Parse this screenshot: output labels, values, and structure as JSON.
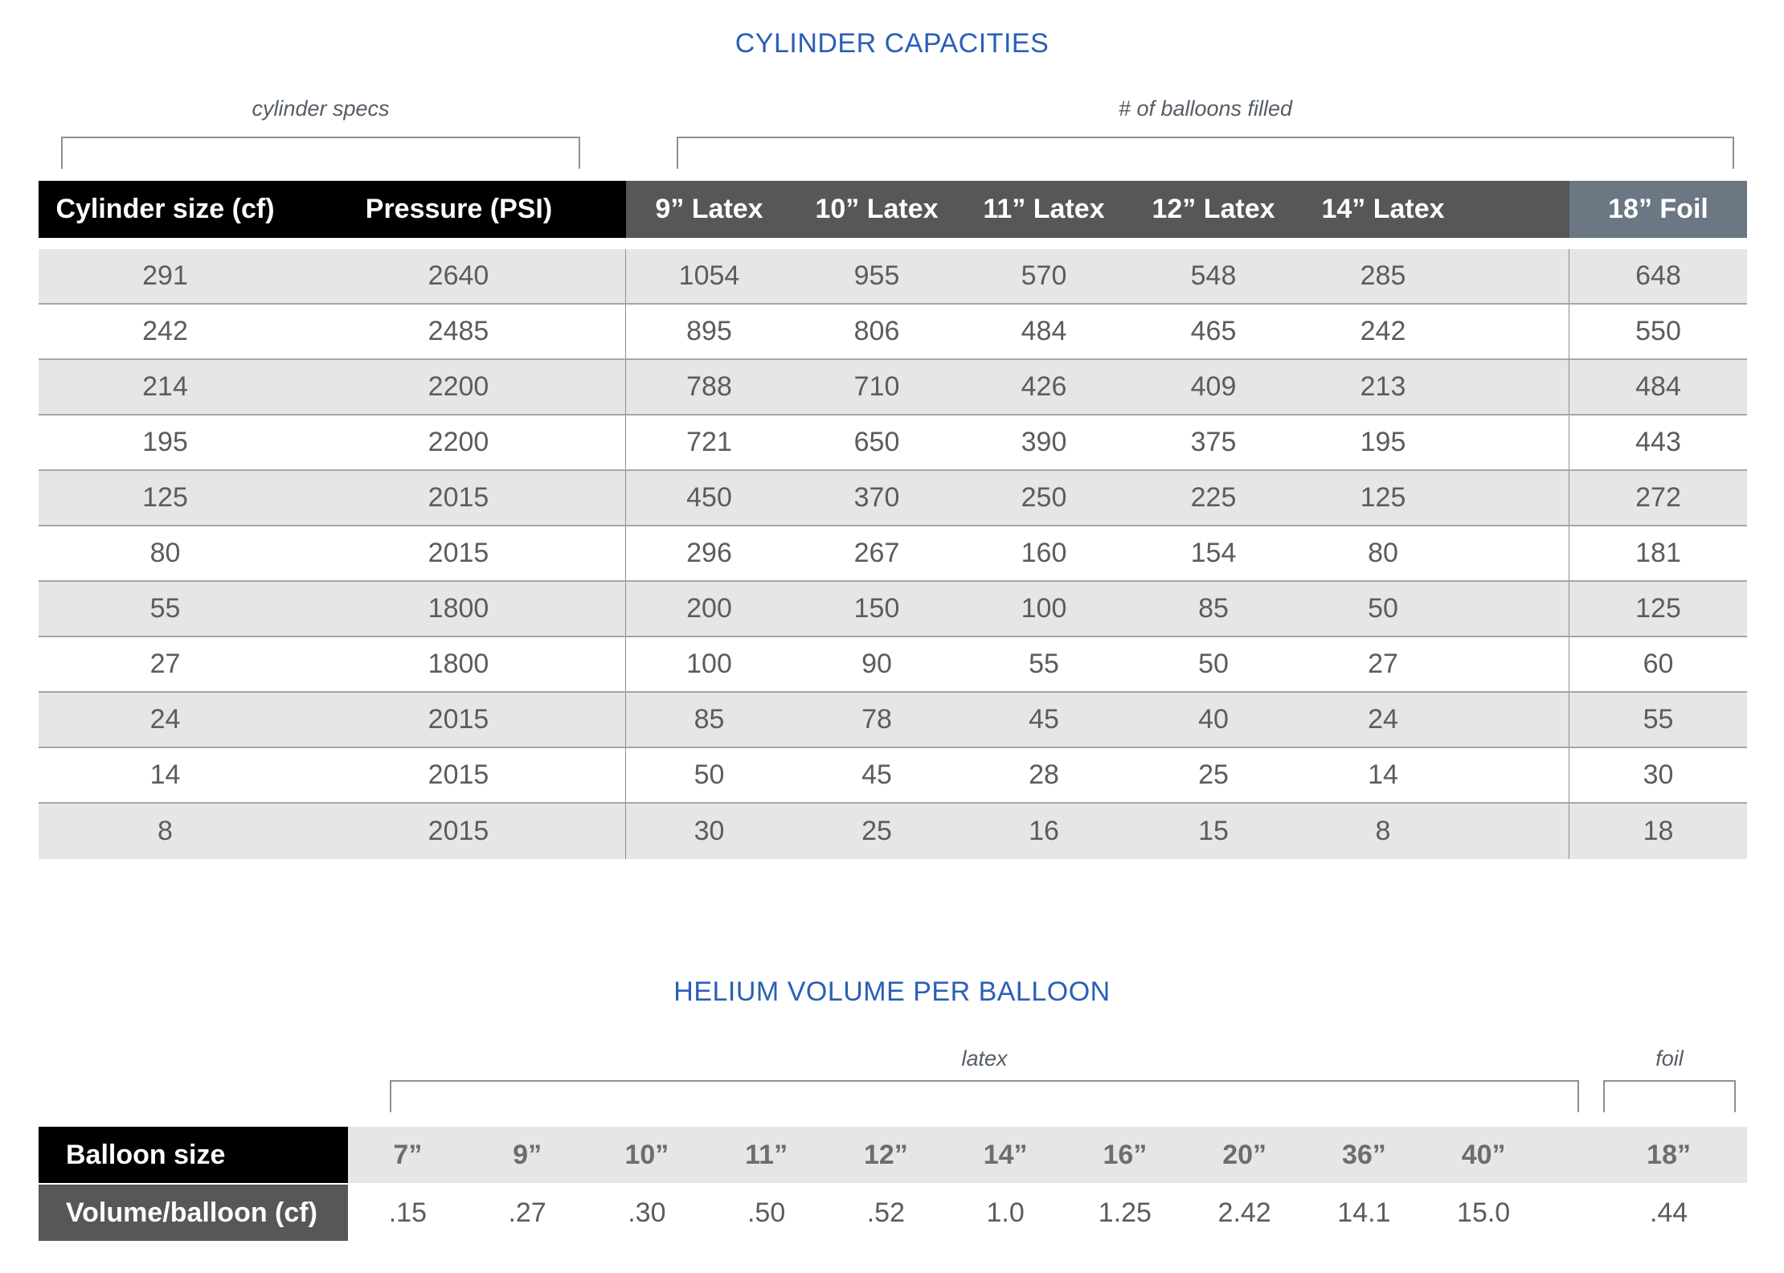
{
  "capacities": {
    "title": "CYLINDER CAPACITIES",
    "group_specs": "cylinder specs",
    "group_balloons": "# of balloons filled",
    "headers": [
      "Cylinder size (cf)",
      "Pressure (PSI)",
      "9” Latex",
      "10” Latex",
      "11” Latex",
      "12” Latex",
      "14” Latex",
      "18” Foil"
    ],
    "rows": [
      [
        "291",
        "2640",
        "1054",
        "955",
        "570",
        "548",
        "285",
        "648"
      ],
      [
        "242",
        "2485",
        "895",
        "806",
        "484",
        "465",
        "242",
        "550"
      ],
      [
        "214",
        "2200",
        "788",
        "710",
        "426",
        "409",
        "213",
        "484"
      ],
      [
        "195",
        "2200",
        "721",
        "650",
        "390",
        "375",
        "195",
        "443"
      ],
      [
        "125",
        "2015",
        "450",
        "370",
        "250",
        "225",
        "125",
        "272"
      ],
      [
        "80",
        "2015",
        "296",
        "267",
        "160",
        "154",
        "80",
        "181"
      ],
      [
        "55",
        "1800",
        "200",
        "150",
        "100",
        "85",
        "50",
        "125"
      ],
      [
        "27",
        "1800",
        "100",
        "90",
        "55",
        "50",
        "27",
        "60"
      ],
      [
        "24",
        "2015",
        "85",
        "78",
        "45",
        "40",
        "24",
        "55"
      ],
      [
        "14",
        "2015",
        "50",
        "45",
        "28",
        "25",
        "14",
        "30"
      ],
      [
        "8",
        "2015",
        "30",
        "25",
        "16",
        "15",
        "8",
        "18"
      ]
    ]
  },
  "volume": {
    "title": "HELIUM VOLUME PER BALLOON",
    "group_latex": "latex",
    "group_foil": "foil",
    "size_label": "Balloon size",
    "volume_label": "Volume/balloon (cf)",
    "sizes": [
      "7”",
      "9”",
      "10”",
      "11”",
      "12”",
      "14”",
      "16”",
      "20”",
      "36”",
      "40”",
      "18”"
    ],
    "volumes": [
      ".15",
      ".27",
      ".30",
      ".50",
      ".52",
      "1.0",
      "1.25",
      "2.42",
      "14.1",
      "15.0",
      ".44"
    ]
  }
}
